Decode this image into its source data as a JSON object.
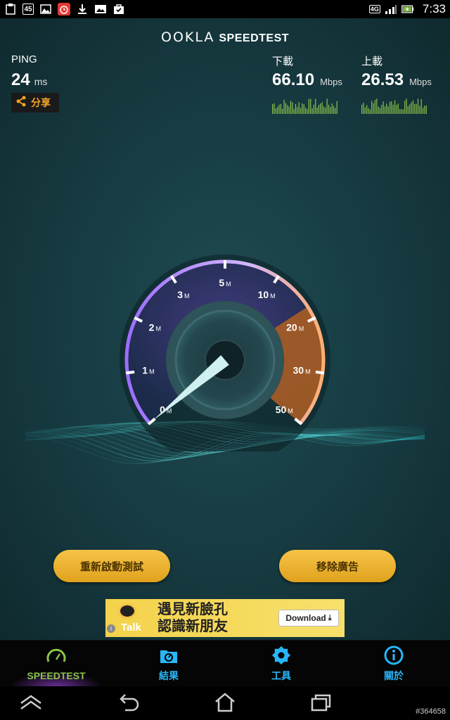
{
  "status_bar": {
    "notification_count": "45",
    "network": "4G",
    "time": "7:33"
  },
  "app": {
    "logo_part1": "OOKLA",
    "logo_part2": "SPEEDTEST",
    "ping": {
      "label": "PING",
      "value": "24",
      "unit": "ms"
    },
    "share_label": "分享",
    "download": {
      "label": "下載",
      "value": "66.10",
      "unit": "Mbps"
    },
    "upload": {
      "label": "上載",
      "value": "26.53",
      "unit": "Mbps"
    },
    "gauge": {
      "ticks": [
        "0",
        "1",
        "2",
        "3",
        "5",
        "10",
        "20",
        "30",
        "50"
      ],
      "tick_unit": "M",
      "needle_value": 0
    },
    "buttons": {
      "restart": "重新啟動測試",
      "remove_ads": "移除廣告"
    },
    "ad": {
      "brand": "Talk",
      "line1": "遇見新臉孔",
      "line2": "認識新朋友",
      "download_label": "Download"
    }
  },
  "tabs": [
    {
      "label": "SPEEDTEST",
      "icon": "gauge-icon",
      "active": true
    },
    {
      "label": "結果",
      "icon": "folder-results-icon",
      "active": false
    },
    {
      "label": "工具",
      "icon": "gear-icon",
      "active": false
    },
    {
      "label": "關於",
      "icon": "info-icon",
      "active": false
    }
  ],
  "nav": [
    "home-up-icon",
    "back-icon",
    "home-icon",
    "recents-icon"
  ],
  "watermark": "#364658",
  "colors": {
    "accent": "#f6c347",
    "tab_active": "#8bc34a",
    "tab_inactive": "#29b6f6",
    "share": "#f4a424"
  }
}
